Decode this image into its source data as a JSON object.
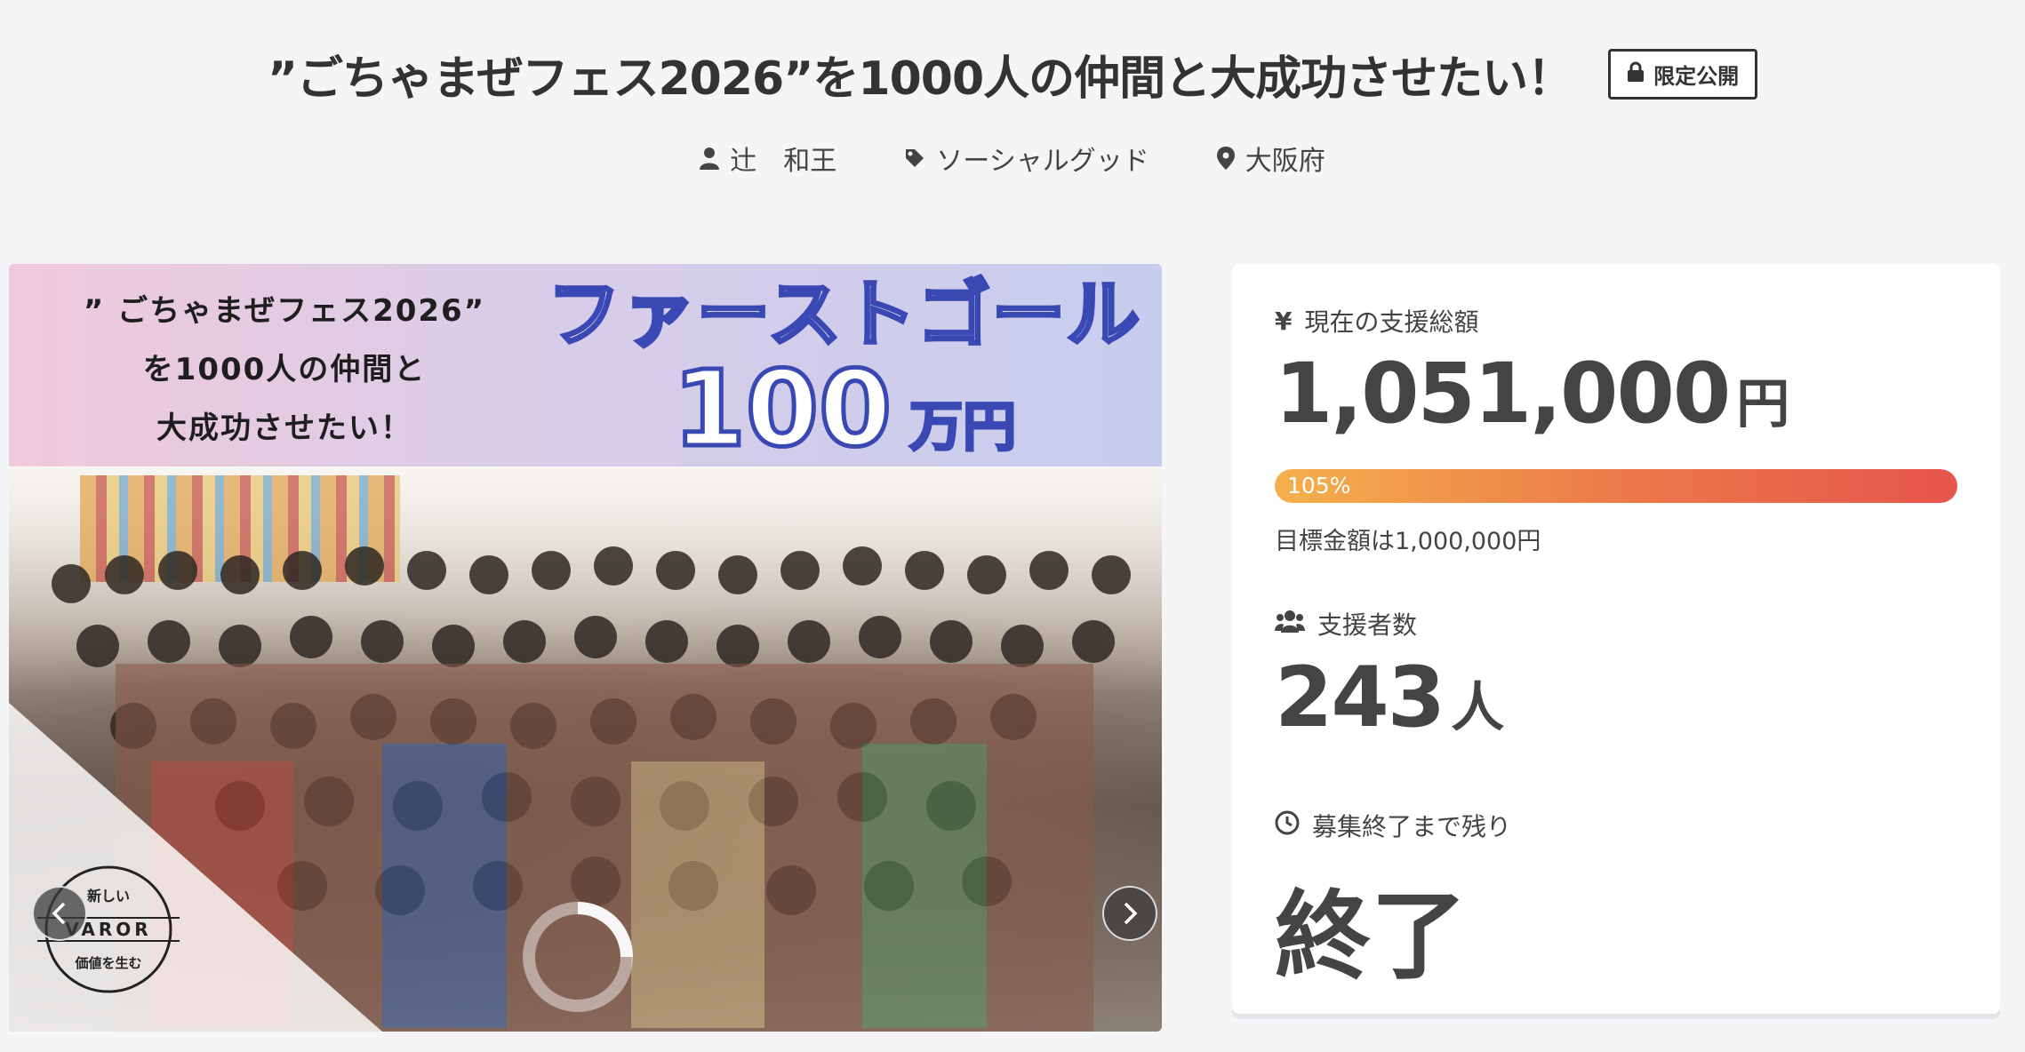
{
  "header": {
    "title": "”ごちゃまぜフェス2026”を1000人の仲間と大成功させたい！",
    "badge": "限定公開"
  },
  "meta": {
    "owner": "辻　和王",
    "category": "ソーシャルグッド",
    "location": "大阪府"
  },
  "hero": {
    "banner_left_line1": "” ごちゃまぜフェス2026”",
    "banner_left_line2": "を1000人の仲間と",
    "banner_left_line3": "大成功させたい！",
    "banner_goal_title": "ファーストゴール",
    "banner_goal_amount": "100",
    "banner_goal_unit": "万円",
    "logo_top": "新しい",
    "logo_middle": "VAROR",
    "logo_bottom": "価値を生む"
  },
  "stats": {
    "total_label": "現在の支援総額",
    "total_amount": "1,051,000",
    "total_unit": "円",
    "progress_percent": 105,
    "progress_label": "105%",
    "goal_text": "目標金額は1,000,000円",
    "backers_label": "支援者数",
    "backers_count": "243",
    "backers_unit": "人",
    "remaining_label": "募集終了まで残り",
    "remaining_value": "終了"
  },
  "colors": {
    "progress_start": "#f4b04c",
    "progress_end": "#e6554b",
    "banner_text_stroke": "#3a48b3"
  }
}
